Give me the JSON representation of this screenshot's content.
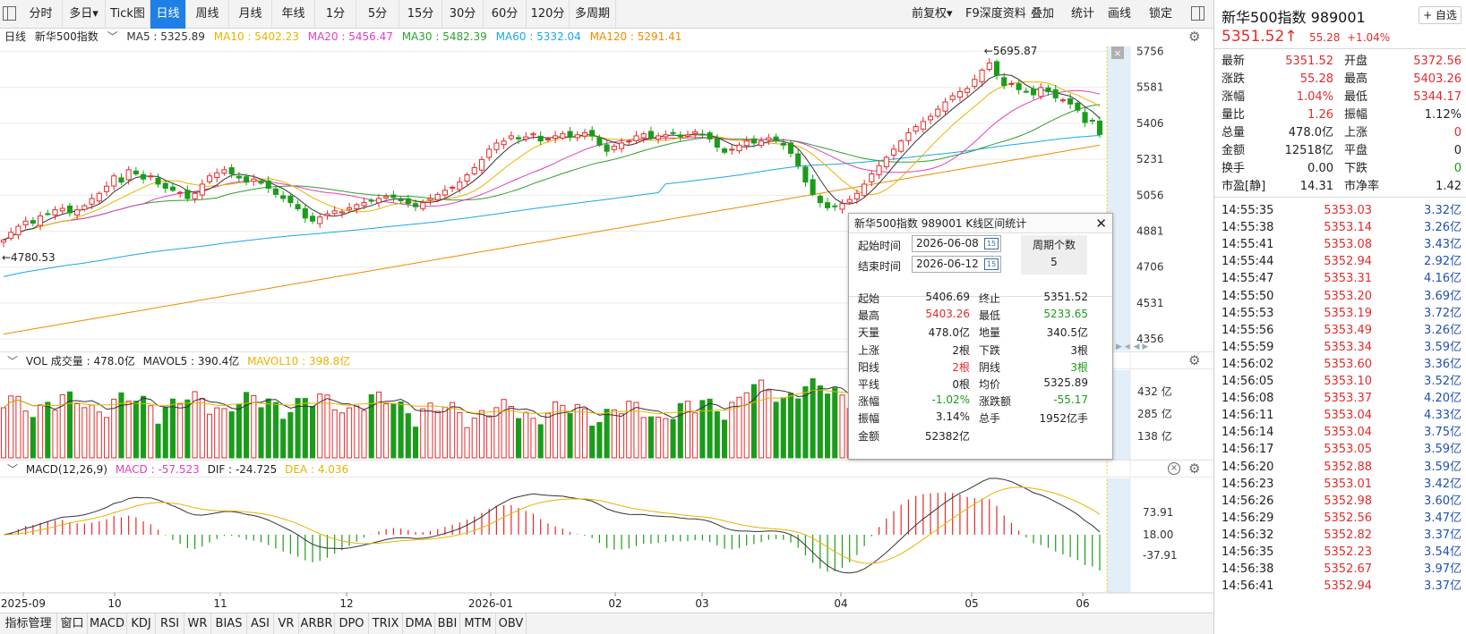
{
  "toolbar": {
    "tabs": [
      "分时",
      "多日",
      "Tick图",
      "日线",
      "周线",
      "月线",
      "年线",
      "1分",
      "5分",
      "15分",
      "30分",
      "60分",
      "120分",
      "多周期"
    ],
    "active": "日线",
    "dropdown_icon": "caret-down-icon",
    "right": [
      "前复权",
      "F9深度资料",
      "叠加",
      "统计",
      "画线",
      "锁定"
    ]
  },
  "info": {
    "period": "日线",
    "name": "新华500指数",
    "ma5": "MA5 : 5325.89",
    "ma10": "MA10 : 5402.23",
    "ma20": "MA20 : 5456.47",
    "ma30": "MA30 : 5482.39",
    "ma60": "MA60 : 5332.04",
    "ma120": "MA120 : 5291.41"
  },
  "colors": {
    "up": "#e32b2b",
    "down": "#1a9c1a",
    "ma5": "#333333",
    "ma10": "#e6b400",
    "ma20": "#e040c0",
    "ma30": "#2e9e2e",
    "ma60": "#1aa7e8",
    "ma120": "#ef8a00",
    "accent": "#1e7fe6"
  },
  "vol": {
    "label": "VOL 成交量 : 478.0亿",
    "mavol5": "MAVOL5 : 390.4亿",
    "mavol10": "MAVOL10 : 398.8亿",
    "ticks": [
      "432 亿",
      "285 亿",
      "138 亿"
    ]
  },
  "macd": {
    "label": "MACD(12,26,9)",
    "macd": "MACD : -57.523",
    "dif": "DIF : -24.725",
    "dea": "DEA : 4.036",
    "ticks": [
      "73.91",
      "18.00",
      "-37.91"
    ]
  },
  "price_axis": [
    "5756",
    "5581",
    "5406",
    "5231",
    "5056",
    "4881",
    "4706",
    "4531",
    "4356"
  ],
  "annotations": {
    "high": "←5695.87",
    "low": "←4780.53"
  },
  "x_labels": [
    "2025-09",
    "10",
    "11",
    "12",
    "2026-01",
    "02",
    "03",
    "04",
    "05",
    "06"
  ],
  "bottom": [
    "指标管理",
    "窗口",
    "MACD",
    "KDJ",
    "RSI",
    "WR",
    "BIAS",
    "ASI",
    "VR",
    "ARBR",
    "DPO",
    "TRIX",
    "DMA",
    "BBI",
    "MTM",
    "OBV"
  ],
  "right": {
    "title": "新华500指数",
    "code": "989001",
    "self_button": "+ 自选",
    "price": "5351.52",
    "arrow": "↑",
    "change": "55.28",
    "change_pct": "+1.04%",
    "quotes": [
      [
        "最新",
        "5351.52",
        "开盘",
        "5372.56"
      ],
      [
        "涨跌",
        "55.28",
        "最高",
        "5403.26"
      ],
      [
        "涨幅",
        "1.04%",
        "最低",
        "5344.17"
      ],
      [
        "量比",
        "1.26",
        "振幅",
        "1.12%"
      ],
      [
        "总量",
        "478.0亿",
        "上涨",
        "0"
      ],
      [
        "金额",
        "12518亿",
        "平盘",
        "0"
      ],
      [
        "换手",
        "0.00",
        "下跌",
        "0"
      ],
      [
        "市盈[静]",
        "14.31",
        "市净率",
        "1.42"
      ]
    ],
    "ticks": [
      [
        "14:55:35",
        "5353.03",
        "3.32亿"
      ],
      [
        "14:55:38",
        "5353.14",
        "3.26亿"
      ],
      [
        "14:55:41",
        "5353.08",
        "3.43亿"
      ],
      [
        "14:55:44",
        "5352.94",
        "2.92亿"
      ],
      [
        "14:55:47",
        "5353.31",
        "4.16亿"
      ],
      [
        "14:55:50",
        "5353.20",
        "3.69亿"
      ],
      [
        "14:55:53",
        "5353.19",
        "3.72亿"
      ],
      [
        "14:55:56",
        "5353.49",
        "3.26亿"
      ],
      [
        "14:55:59",
        "5353.34",
        "3.59亿"
      ],
      [
        "14:56:02",
        "5353.60",
        "3.36亿"
      ],
      [
        "14:56:05",
        "5353.10",
        "3.52亿"
      ],
      [
        "14:56:08",
        "5353.37",
        "4.20亿"
      ],
      [
        "14:56:11",
        "5353.04",
        "4.33亿"
      ],
      [
        "14:56:14",
        "5353.04",
        "3.75亿"
      ],
      [
        "14:56:17",
        "5353.05",
        "3.59亿"
      ],
      [
        "14:56:20",
        "5352.88",
        "3.59亿"
      ],
      [
        "14:56:23",
        "5353.01",
        "3.42亿"
      ],
      [
        "14:56:26",
        "5352.98",
        "3.60亿"
      ],
      [
        "14:56:29",
        "5352.56",
        "3.47亿"
      ],
      [
        "14:56:32",
        "5352.82",
        "3.37亿"
      ],
      [
        "14:56:35",
        "5352.23",
        "3.54亿"
      ],
      [
        "14:56:38",
        "5352.67",
        "3.97亿"
      ],
      [
        "14:56:41",
        "5352.94",
        "3.37亿"
      ]
    ]
  },
  "popup": {
    "title": "新华500指数 989001 K线区间统计",
    "start_label": "起始时间",
    "start": "2026-06-08",
    "end_label": "结束时间",
    "end": "2026-06-12",
    "cal": "15",
    "period_label": "周期个数",
    "period": "5",
    "stats": [
      [
        "起始",
        "5406.69",
        "终止",
        "5351.52"
      ],
      [
        "最高",
        "5403.26",
        "最低",
        "5233.65"
      ],
      [
        "天量",
        "478.0亿",
        "地量",
        "340.5亿"
      ],
      [
        "上涨",
        "2根",
        "下跌",
        "3根"
      ],
      [
        "阳线",
        "2根",
        "阴线",
        "3根"
      ],
      [
        "平线",
        "0根",
        "均价",
        "5325.89"
      ],
      [
        "涨幅",
        "-1.02%",
        "涨跌额",
        "-55.17"
      ],
      [
        "振幅",
        "3.14%",
        "总手",
        "1952亿手"
      ],
      [
        "金额",
        "52382亿",
        "",
        ""
      ]
    ]
  },
  "chart_data": {
    "type": "candlestick",
    "title": "新华500指数",
    "ylim": [
      4300,
      5780
    ],
    "closes": [
      4838,
      4875,
      4905,
      4930,
      4920,
      4955,
      4965,
      4985,
      4992,
      4970,
      4985,
      5005,
      5040,
      5065,
      5100,
      5150,
      5120,
      5180,
      5160,
      5135,
      5150,
      5110,
      5090,
      5080,
      5070,
      5040,
      5065,
      5110,
      5150,
      5165,
      5180,
      5160,
      5140,
      5120,
      5135,
      5115,
      5090,
      5060,
      5040,
      5020,
      4990,
      4945,
      4930,
      4950,
      4965,
      4980,
      4975,
      4995,
      5010,
      5020,
      5030,
      5040,
      5050,
      5045,
      5030,
      5015,
      5000,
      5020,
      5040,
      5060,
      5080,
      5095,
      5120,
      5155,
      5190,
      5230,
      5280,
      5310,
      5320,
      5345,
      5330,
      5340,
      5355,
      5320,
      5330,
      5345,
      5355,
      5340,
      5350,
      5360,
      5345,
      5300,
      5270,
      5295,
      5310,
      5320,
      5345,
      5355,
      5335,
      5345,
      5350,
      5360,
      5340,
      5350,
      5365,
      5350,
      5330,
      5290,
      5265,
      5280,
      5300,
      5320,
      5310,
      5320,
      5335,
      5320,
      5300,
      5260,
      5200,
      5120,
      5060,
      5020,
      4995,
      5000,
      5015,
      5035,
      5065,
      5110,
      5160,
      5200,
      5240,
      5280,
      5320,
      5360,
      5390,
      5415,
      5440,
      5475,
      5510,
      5540,
      5560,
      5575,
      5620,
      5665,
      5700,
      5640,
      5590,
      5600,
      5570,
      5560,
      5545,
      5580,
      5560,
      5530,
      5520,
      5500,
      5470,
      5410,
      5420,
      5351.52
    ]
  }
}
